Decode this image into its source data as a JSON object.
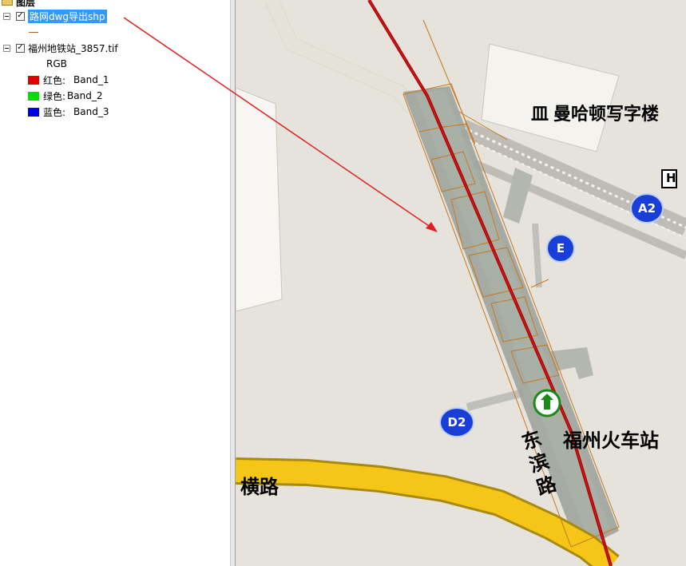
{
  "toc": {
    "root_label": "图层",
    "layers": [
      {
        "name": "路网dwg导出shp",
        "checked": true,
        "selected": true
      },
      {
        "name": "福州地铁站_3857.tif",
        "checked": true,
        "selected": false
      }
    ],
    "legend_header": "RGB",
    "bands": [
      {
        "label": "红色:",
        "band": "Band_1",
        "color": "#e00000"
      },
      {
        "label": "绿色:",
        "band": "Band_2",
        "color": "#00e000"
      },
      {
        "label": "蓝色:",
        "band": "Band_3",
        "color": "#0000e0"
      }
    ]
  },
  "map": {
    "labels": {
      "building": "曼哈顿写字楼",
      "station": "福州火车站",
      "road_left": "横路",
      "road_vertical": "东滨路"
    },
    "badges": {
      "a2": "A2",
      "e": "E",
      "d2": "D2"
    },
    "hospital_letter": "H",
    "building_prefix": "皿"
  },
  "colors": {
    "selection": "#3399ff",
    "annotation_arrow": "#e02020",
    "road_line": "#b00000",
    "parcel_outline": "#c87820",
    "map_background": "#e6e3dc"
  }
}
